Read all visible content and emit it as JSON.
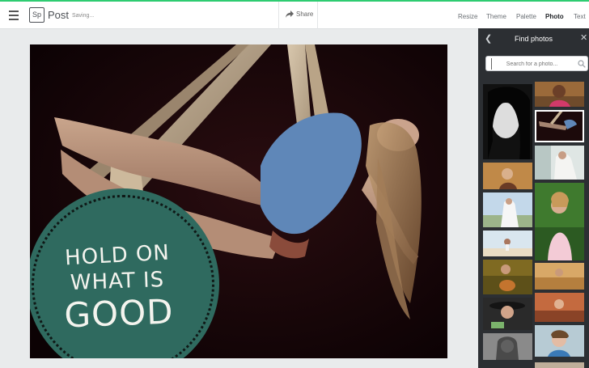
{
  "header": {
    "logo_text": "Sp",
    "app_name": "Post",
    "status": "Saving...",
    "share_label": "Share",
    "nav": [
      "Resize",
      "Theme",
      "Palette",
      "Photo",
      "Text"
    ],
    "active_nav": "Photo",
    "accent_color": "#2ecc71"
  },
  "design": {
    "quote_lines": [
      "HOLD ON",
      "WHAT IS",
      "GOOD"
    ],
    "badge_color": "#2f6a5f",
    "background_color": "#160508"
  },
  "panel": {
    "title": "Find photos",
    "back_icon": "chevron-left-icon",
    "close_icon": "close-icon",
    "search_placeholder": "Search for a photo...",
    "search_icon": "search-icon",
    "selected_thumbnail": "aerial-silk"
  }
}
